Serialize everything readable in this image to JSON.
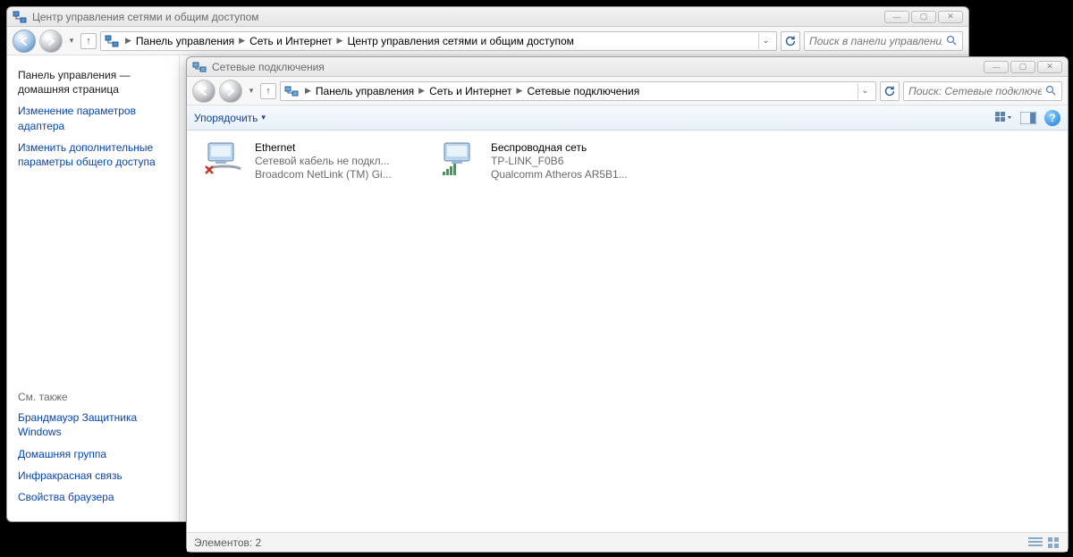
{
  "back": {
    "title": "Центр управления сетями и общим доступом",
    "breadcrumb": [
      "Панель управления",
      "Сеть и Интернет",
      "Центр управления сетями и общим доступом"
    ],
    "search_placeholder": "Поиск в панели управления",
    "sidebar": {
      "home_line1": "Панель управления —",
      "home_line2": "домашняя страница",
      "link_adapter": "Изменение параметров адаптера",
      "link_sharing": "Изменить дополнительные параметры общего доступа",
      "see_also": "См. также",
      "firewall": "Брандмауэр Защитника Windows",
      "homegroup": "Домашняя группа",
      "infrared": "Инфракрасная связь",
      "browser": "Свойства браузера"
    }
  },
  "front": {
    "title": "Сетевые подключения",
    "breadcrumb": [
      "Панель управления",
      "Сеть и Интернет",
      "Сетевые подключения"
    ],
    "search_placeholder": "Поиск: Сетевые подключения",
    "toolbar": {
      "organize": "Упорядочить"
    },
    "connections": [
      {
        "name": "Ethernet",
        "line2": "Сетевой кабель не подкл...",
        "line3": "Broadcom NetLink (TM) Gi...",
        "status": "disconnected"
      },
      {
        "name": "Беспроводная сеть",
        "line2": "TP-LINK_F0B6",
        "line3": "Qualcomm Atheros AR5B1...",
        "status": "connected"
      }
    ],
    "statusbar": {
      "count_label": "Элементов: 2"
    }
  }
}
